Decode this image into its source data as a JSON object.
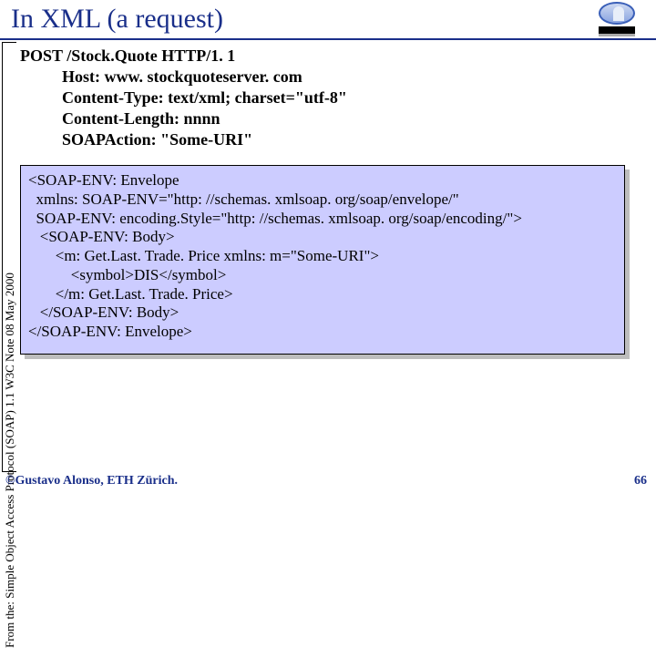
{
  "header": {
    "title": "In XML (a request)"
  },
  "side_citation": "From the: Simple Object Access Protocol (SOAP) 1.1 W3C Note 08 May 2000",
  "http": {
    "request_line": "POST /Stock.Quote HTTP/1. 1",
    "headers": [
      "Host: www. stockquoteserver. com",
      "Content-Type: text/xml; charset=\"utf-8\"",
      "Content-Length: nnnn",
      "SOAPAction: \"Some-URI\""
    ]
  },
  "xml_lines": [
    "<SOAP-ENV: Envelope",
    "  xmlns: SOAP-ENV=\"http: //schemas. xmlsoap. org/soap/envelope/\"",
    "  SOAP-ENV: encoding.Style=\"http: //schemas. xmlsoap. org/soap/encoding/\">",
    "   <SOAP-ENV: Body>",
    "       <m: Get.Last. Trade. Price xmlns: m=\"Some-URI\">",
    "           <symbol>DIS</symbol>",
    "       </m: Get.Last. Trade. Price>",
    "   </SOAP-ENV: Body>",
    "</SOAP-ENV: Envelope>"
  ],
  "footer": {
    "left": "©Gustavo Alonso,  ETH Zürich.",
    "right": "66"
  }
}
